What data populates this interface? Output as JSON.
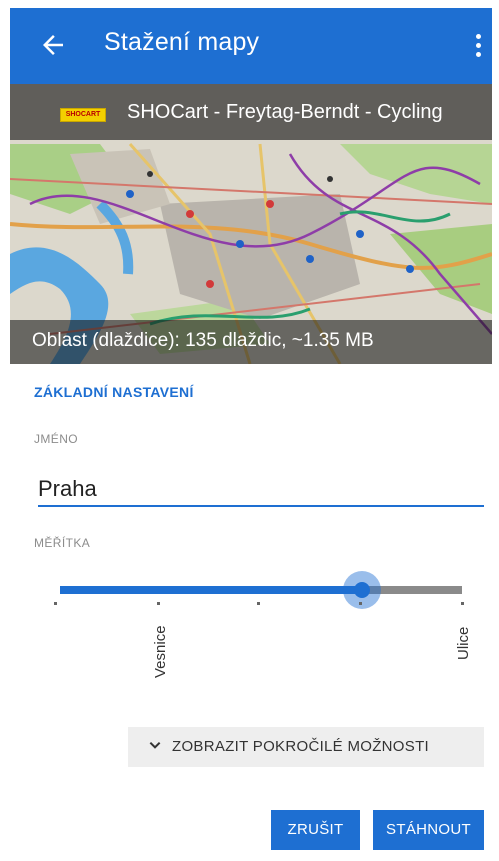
{
  "appbar": {
    "title": "Stažení mapy",
    "back_icon": "arrow-left-icon",
    "menu_icon": "more-vert-icon",
    "color": "#1e6fd2"
  },
  "map": {
    "logo_text": "SHOCART",
    "title": "SHOCart - Freytag-Berndt - Cycling",
    "info": "Oblast (dlaždice): 135 dlaždic, ~1.35 MB"
  },
  "settings": {
    "section_title": "ZÁKLADNÍ NASTAVENÍ",
    "name_label": "JMÉNO",
    "name_value": "Praha",
    "scale_label": "MĚŘÍTKA",
    "scale_min_label": "Vesnice",
    "scale_max_label": "Ulice",
    "scale_fraction": 0.75
  },
  "advanced_button": {
    "label": "ZOBRAZIT POKROČILÉ MOŽNOSTI",
    "icon": "chevron-down-icon"
  },
  "actions": {
    "cancel": "ZRUŠIT",
    "download": "STÁHNOUT"
  }
}
